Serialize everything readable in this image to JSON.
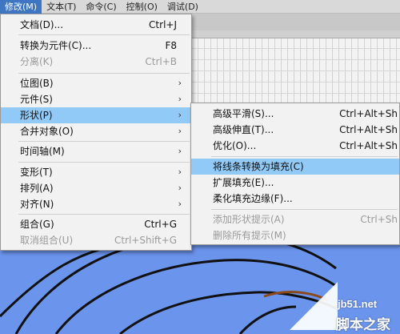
{
  "menubar": {
    "items": [
      {
        "label": "修改(M)",
        "active": true
      },
      {
        "label": "文本(T)"
      },
      {
        "label": "命令(C)"
      },
      {
        "label": "控制(O)"
      },
      {
        "label": "调试(D)"
      }
    ]
  },
  "modify_menu": {
    "items": [
      {
        "label": "文档(D)...",
        "shortcut": "Ctrl+J"
      },
      {
        "label": "转换为元件(C)...",
        "shortcut": "F8"
      },
      {
        "label": "分离(K)",
        "shortcut": "Ctrl+B",
        "disabled": true
      },
      {
        "label": "位图(B)",
        "submenu": true
      },
      {
        "label": "元件(S)",
        "submenu": true
      },
      {
        "label": "形状(P)",
        "submenu": true,
        "highlighted": true
      },
      {
        "label": "合并对象(O)",
        "submenu": true
      },
      {
        "label": "时间轴(M)",
        "submenu": true
      },
      {
        "label": "变形(T)",
        "submenu": true
      },
      {
        "label": "排列(A)",
        "submenu": true
      },
      {
        "label": "对齐(N)",
        "submenu": true
      },
      {
        "label": "组合(G)",
        "shortcut": "Ctrl+G"
      },
      {
        "label": "取消组合(U)",
        "shortcut": "Ctrl+Shift+G",
        "disabled": true
      }
    ],
    "submenu_arrow": "›"
  },
  "shape_submenu": {
    "items": [
      {
        "label": "高级平滑(S)...",
        "shortcut": "Ctrl+Alt+Sh"
      },
      {
        "label": "高级伸直(T)...",
        "shortcut": "Ctrl+Alt+Sh"
      },
      {
        "label": "优化(O)...",
        "shortcut": "Ctrl+Alt+Sh"
      },
      {
        "label": "将线条转换为填充(C)",
        "highlighted": true
      },
      {
        "label": "扩展填充(E)..."
      },
      {
        "label": "柔化填充边缘(F)..."
      },
      {
        "label": "添加形状提示(A)",
        "shortcut": "Ctrl+Sh",
        "disabled": true
      },
      {
        "label": "删除所有提示(M)",
        "disabled": true
      }
    ]
  },
  "watermark": {
    "url": "jb51.net",
    "name": "脚本之家"
  },
  "colors": {
    "menu_bg": "#f2f2f2",
    "highlight": "#91c9f7",
    "active_menubar": "#3f76c4",
    "canvas": "#6b94ec",
    "disabled_text": "#9a9a9a"
  }
}
